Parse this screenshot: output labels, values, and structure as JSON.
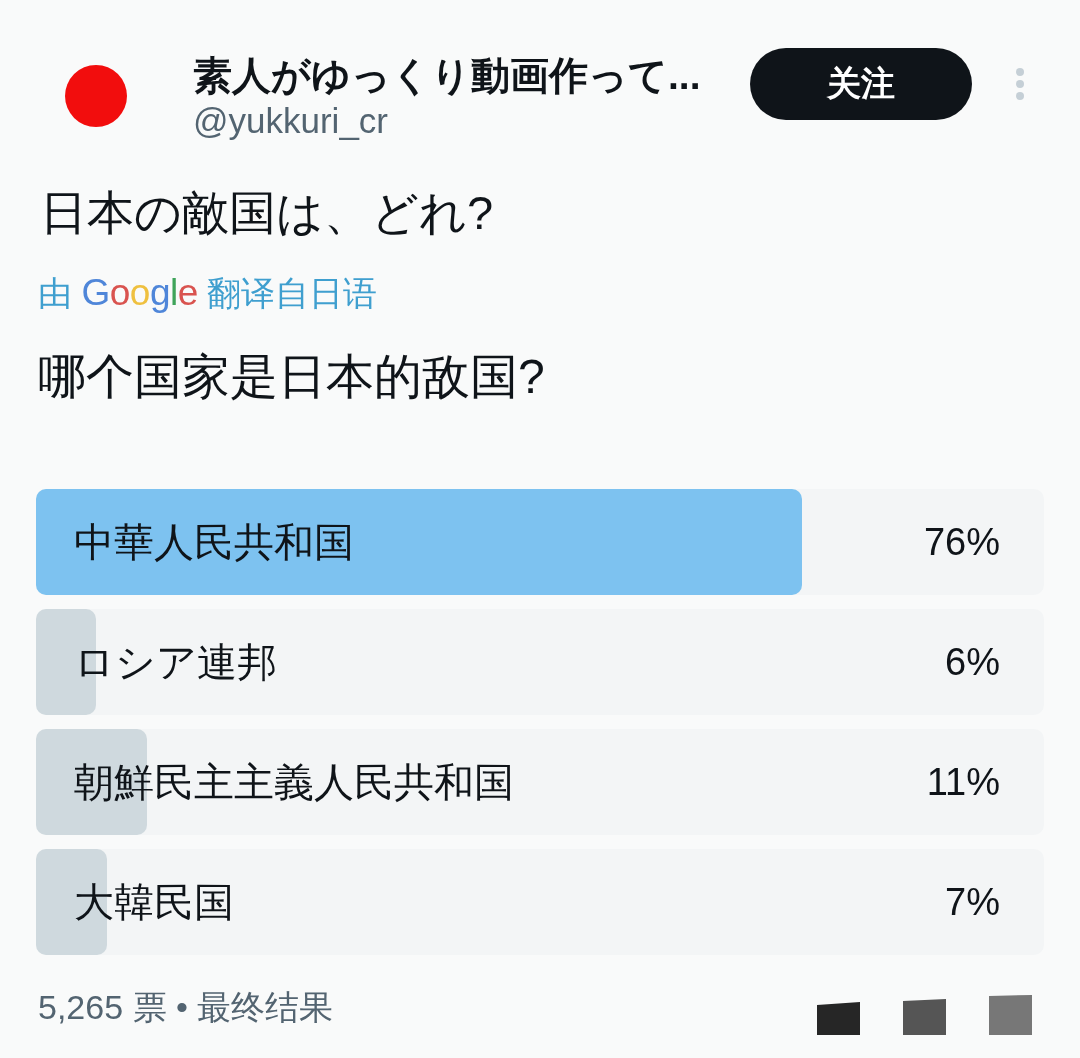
{
  "author": {
    "name": "素人がゆっくり動画作って...",
    "handle": "@yukkuri_cr"
  },
  "follow_button": {
    "label": "关注"
  },
  "post": {
    "text": "日本の敵国は、どれ?",
    "translation_note": {
      "prefix": "由",
      "logo": "Google",
      "suffix": "翻译自日语"
    },
    "translated_text": "哪个国家是日本的敌国?"
  },
  "poll": {
    "options": [
      {
        "label": "中華人民共和国",
        "percent": "76%",
        "level": 0.76,
        "leading": true
      },
      {
        "label": "ロシア連邦",
        "percent": "6%",
        "level": 0.06,
        "leading": false
      },
      {
        "label": "朝鮮民主主義人民共和国",
        "percent": "11%",
        "level": 0.11,
        "leading": false
      },
      {
        "label": "大韓民国",
        "percent": "7%",
        "level": 0.07,
        "leading": false
      }
    ],
    "summary": "5,265 票 • 最终结果"
  }
}
